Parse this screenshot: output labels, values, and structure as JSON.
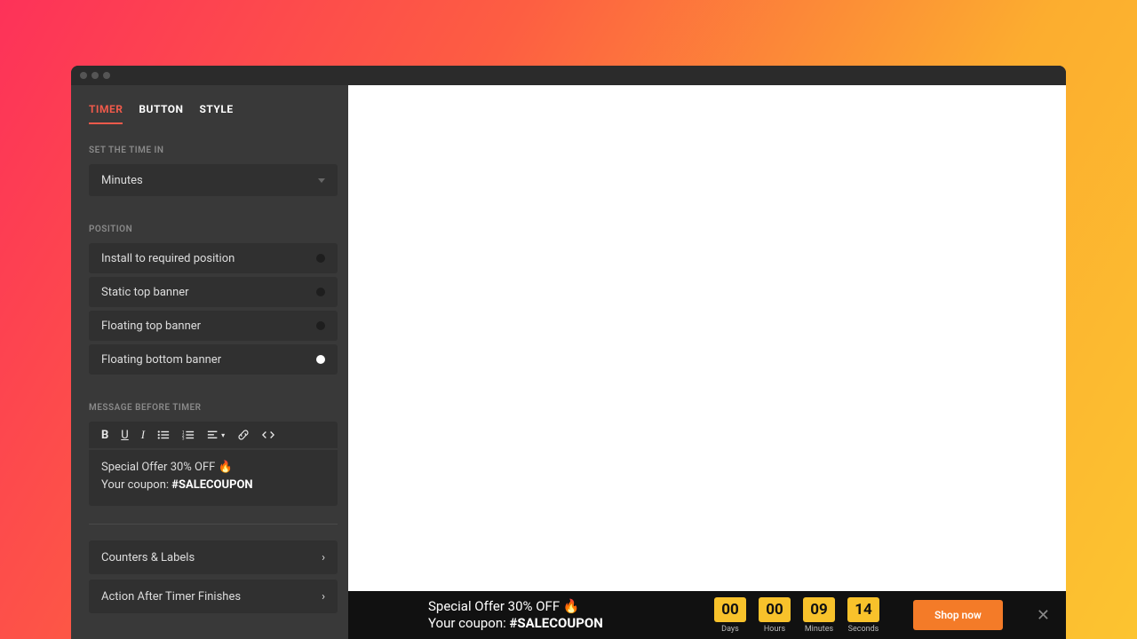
{
  "tabs": {
    "timer": "TIMER",
    "button": "BUTTON",
    "style": "STYLE"
  },
  "time": {
    "label": "SET THE TIME IN",
    "value": "Minutes"
  },
  "position": {
    "label": "POSITION",
    "options": [
      {
        "label": "Install to required position",
        "checked": false
      },
      {
        "label": "Static top banner",
        "checked": false
      },
      {
        "label": "Floating top banner",
        "checked": false
      },
      {
        "label": "Floating bottom banner",
        "checked": true
      }
    ]
  },
  "message": {
    "label": "MESSAGE BEFORE TIMER",
    "line1": "Special Offer 30% OFF 🔥",
    "line2_prefix": "Your coupon: ",
    "coupon": "#SALECOUPON"
  },
  "accordion": {
    "counters": "Counters & Labels",
    "action": "Action After Timer Finishes"
  },
  "banner": {
    "line1": "Special Offer 30% OFF 🔥",
    "line2_prefix": "Your coupon: ",
    "coupon": "#SALECOUPON",
    "counters": [
      {
        "value": "00",
        "label": "Days"
      },
      {
        "value": "00",
        "label": "Hours"
      },
      {
        "value": "09",
        "label": "Minutes"
      },
      {
        "value": "14",
        "label": "Seconds"
      }
    ],
    "cta": "Shop now"
  }
}
